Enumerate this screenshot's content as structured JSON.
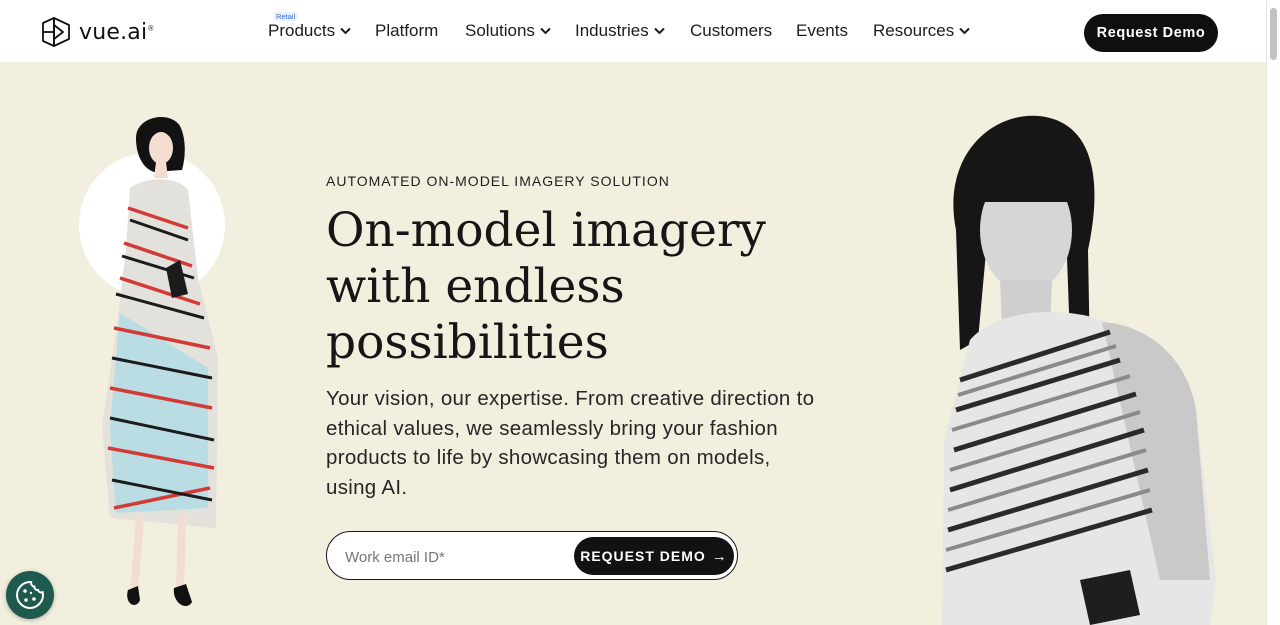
{
  "brand": {
    "logo_text": "vue.ai",
    "logo_mark": "®"
  },
  "nav": {
    "retail_badge": "Retail",
    "items": [
      {
        "label": "Products",
        "has_dropdown": true
      },
      {
        "label": "Platform",
        "has_dropdown": false
      },
      {
        "label": "Solutions",
        "has_dropdown": true
      },
      {
        "label": "Industries",
        "has_dropdown": true
      },
      {
        "label": "Customers",
        "has_dropdown": false
      },
      {
        "label": "Events",
        "has_dropdown": false
      },
      {
        "label": "Resources",
        "has_dropdown": true
      }
    ],
    "cta_label": "Request Demo"
  },
  "hero": {
    "eyebrow": "AUTOMATED ON-MODEL IMAGERY SOLUTION",
    "headline": "On-model imagery with endless possibilities",
    "subcopy": "Your vision, our expertise. From creative direction to ethical values, we seamlessly bring your fashion products to life by showcasing them on models, using AI.",
    "email_placeholder": "Work email ID*",
    "form_cta_label": "REQUEST DEMO",
    "form_cta_arrow": "→"
  },
  "icons": {
    "logo": "vue-ai-logo-icon",
    "dropdown": "chevron-down-icon",
    "cookie": "cookie-icon",
    "arrow": "arrow-right-icon"
  },
  "colors": {
    "page_background": "#f3efdf",
    "header_background": "#ffffff",
    "cta_background": "#0f0f0f",
    "cta_text": "#ffffff",
    "retail_badge": "#3a6fd8",
    "cookie_button": "#1f5a4f"
  }
}
